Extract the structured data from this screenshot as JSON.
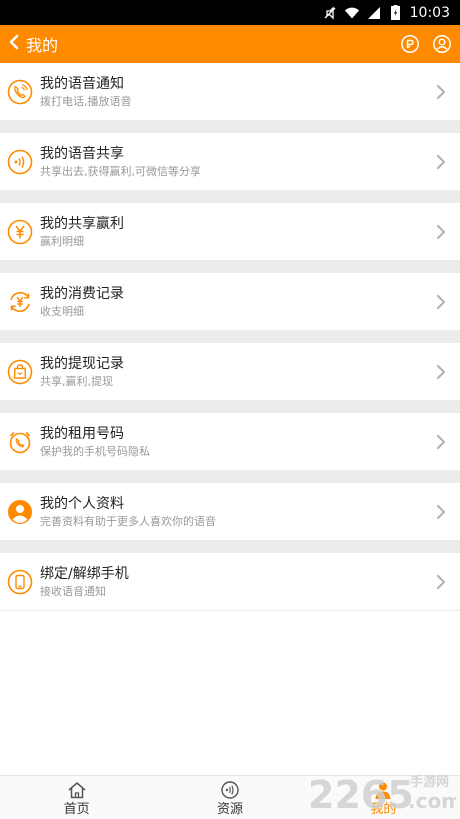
{
  "status_bar": {
    "time": "10:03",
    "icons": [
      "mute-icon",
      "wifi-icon",
      "signal-icon",
      "battery-icon"
    ]
  },
  "header": {
    "back_icon": "chevron-left-icon",
    "title": "我的",
    "actions": [
      "message-icon",
      "user-icon"
    ]
  },
  "menu": {
    "items": [
      {
        "icon": "phone-voice-icon",
        "title": "我的语音通知",
        "subtitle": "拨打电话,播放语音"
      },
      {
        "icon": "voice-share-icon",
        "title": "我的语音共享",
        "subtitle": "共享出去,获得赢利,可微信等分享"
      },
      {
        "icon": "yuan-icon",
        "title": "我的共享赢利",
        "subtitle": "赢利明细"
      },
      {
        "icon": "yuan-refresh-icon",
        "title": "我的消费记录",
        "subtitle": "收支明细"
      },
      {
        "icon": "bag-icon",
        "title": "我的提现记录",
        "subtitle": "共享,赢利,提现"
      },
      {
        "icon": "alarm-phone-icon",
        "title": "我的租用号码",
        "subtitle": "保护我的手机号码隐私"
      },
      {
        "icon": "person-icon",
        "title": "我的个人资料",
        "subtitle": "完善资料有助于更多人喜欢你的语音"
      },
      {
        "icon": "mobile-icon",
        "title": "绑定/解绑手机",
        "subtitle": "接收语音通知"
      }
    ]
  },
  "bottom_nav": {
    "items": [
      {
        "icon": "home-icon",
        "label": "首页"
      },
      {
        "icon": "resource-icon",
        "label": "资源"
      },
      {
        "icon": "me-icon",
        "label": "我的"
      }
    ],
    "active_index": 2
  },
  "watermark": {
    "text": "2265",
    "domain": ".com",
    "site": "手游网"
  },
  "colors": {
    "accent": "#ff8a00",
    "separator": "#ececec",
    "title_text": "#222222",
    "subtitle_text": "#999999"
  }
}
